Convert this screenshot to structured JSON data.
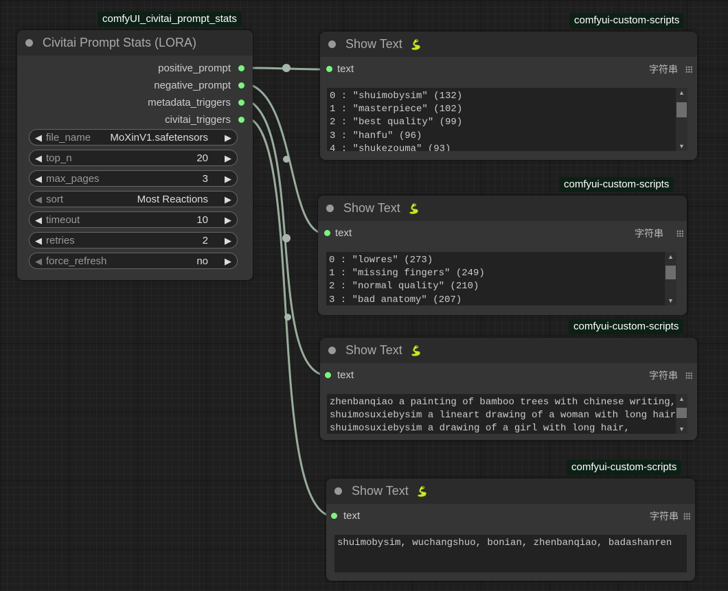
{
  "source_node": {
    "badge": "comfyUI_civitai_prompt_stats",
    "title": "Civitai Prompt Stats (LORA)",
    "outputs": [
      "positive_prompt",
      "negative_prompt",
      "metadata_triggers",
      "civitai_triggers"
    ],
    "widgets": [
      {
        "name": "file_name",
        "value": "MoXinV1.safetensors"
      },
      {
        "name": "top_n",
        "value": "20"
      },
      {
        "name": "max_pages",
        "value": "3"
      },
      {
        "name": "sort",
        "value": "Most Reactions"
      },
      {
        "name": "timeout",
        "value": "10"
      },
      {
        "name": "retries",
        "value": "2"
      },
      {
        "name": "force_refresh",
        "value": "no"
      }
    ]
  },
  "show_text_nodes": [
    {
      "badge": "comfyui-custom-scripts",
      "title": "Show Text",
      "input": "text",
      "type_label": "字符串",
      "content": "0 : \"shuimobysim\" (132)\n1 : \"masterpiece\" (102)\n2 : \"best quality\" (99)\n3 : \"hanfu\" (96)\n4 : \"shukezouma\" (93)"
    },
    {
      "badge": "comfyui-custom-scripts",
      "title": "Show Text",
      "input": "text",
      "type_label": "字符串",
      "content": "0 : \"lowres\" (273)\n1 : \"missing fingers\" (249)\n2 : \"normal quality\" (210)\n3 : \"bad anatomy\" (207)"
    },
    {
      "badge": "comfyui-custom-scripts",
      "title": "Show Text",
      "input": "text",
      "type_label": "字符串",
      "content": "zhenbanqiao a painting of bamboo trees with chinese writing,\nshuimosuxiebysim a lineart drawing of a woman with long hair,\nshuimosuxiebysim a drawing of a girl with long hair,"
    },
    {
      "badge": "comfyui-custom-scripts",
      "title": "Show Text",
      "input": "text",
      "type_label": "字符串",
      "content": "shuimobysim, wuchangshuo, bonian, zhenbanqiao, badashanren"
    }
  ],
  "colors": {
    "slot_dot": "#7cf47e",
    "wire": "#9fb5a4",
    "badge_bg": "#0d2016",
    "snake_icon": "#c7e62a"
  },
  "icons": {
    "snake": "snake-icon",
    "grip": "grip-icon",
    "left_arrow": "left-arrow-icon",
    "right_arrow": "right-arrow-icon"
  }
}
